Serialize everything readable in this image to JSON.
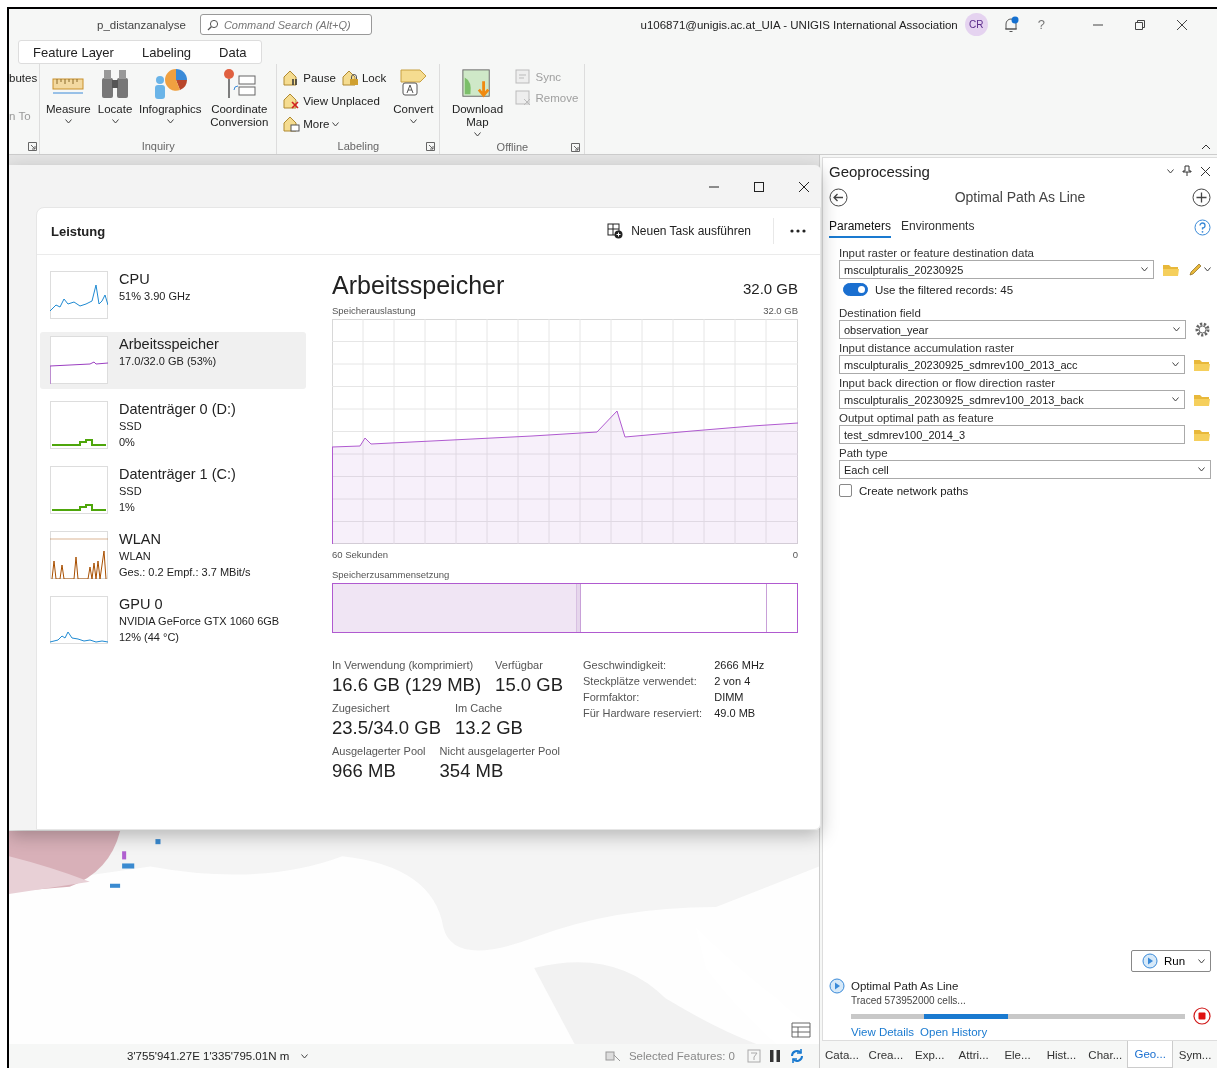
{
  "app": {
    "project": "p_distanzanalyse",
    "search_placeholder": "Command Search (Alt+Q)",
    "account": "u106871@unigis.ac.at_UIA - UNIGIS International Association",
    "avatar": "CR",
    "help": "?",
    "notification": true
  },
  "ribbon_tabs": [
    {
      "label": "Feature Layer"
    },
    {
      "label": "Labeling"
    },
    {
      "label": "Data"
    }
  ],
  "ribbon_cut_commands": [
    {
      "label": "butes",
      "disabled": false
    },
    {
      "label": "n To",
      "disabled": true
    }
  ],
  "ribbon_groups": [
    {
      "label": "Inquiry",
      "large": [
        {
          "kind": "measure",
          "label": "Measure",
          "dropdown": true
        },
        {
          "kind": "locate",
          "label": "Locate",
          "dropdown": true
        },
        {
          "kind": "infographics",
          "label": "Infographics",
          "dropdown": true
        },
        {
          "kind": "coordinate",
          "label": "Coordinate Conversion",
          "dropdown": false
        }
      ],
      "launcher": false
    },
    {
      "label": "Labeling",
      "small": [
        {
          "kind": "pause",
          "label": "Pause",
          "dropdown": false,
          "disabled": false
        },
        {
          "kind": "lock",
          "label": "Lock",
          "dropdown": false,
          "disabled": false
        },
        {
          "kind": "unplaced",
          "label": "View Unplaced",
          "dropdown": false,
          "disabled": false
        },
        {
          "kind": "more",
          "label": "More",
          "dropdown": true,
          "disabled": false
        }
      ],
      "large_after": [
        {
          "kind": "convert",
          "label": "Convert",
          "dropdown": true
        }
      ],
      "launcher": true
    },
    {
      "label": "Offline",
      "large": [
        {
          "kind": "download",
          "label": "Download Map",
          "dropdown": true
        }
      ],
      "small": [
        {
          "kind": "sync",
          "label": "Sync",
          "dropdown": false,
          "disabled": true
        },
        {
          "kind": "remove",
          "label": "Remove",
          "dropdown": false,
          "disabled": true
        }
      ],
      "launcher": true
    }
  ],
  "status_bar": {
    "coordinates": "3'755'941.27E 1'335'795.01N m",
    "selected_features": "Selected Features: 0"
  },
  "task_manager": {
    "section": "Leistung",
    "run_task": "Neuen Task ausführen",
    "resources": [
      {
        "kind": "cpu",
        "name": "CPU",
        "lines": [
          "51%  3.90 GHz"
        ],
        "color": "#1f8ad2",
        "selected": false
      },
      {
        "kind": "memory",
        "name": "Arbeitsspeicher",
        "lines": [
          "17.0/32.0 GB (53%)"
        ],
        "color": "#9b3fc1",
        "selected": true
      },
      {
        "kind": "disk",
        "name": "Datenträger 0 (D:)",
        "lines": [
          "SSD",
          "0%"
        ],
        "color": "#4ea60b",
        "selected": false
      },
      {
        "kind": "disk",
        "name": "Datenträger 1 (C:)",
        "lines": [
          "SSD",
          "1%"
        ],
        "color": "#4ea60b",
        "selected": false
      },
      {
        "kind": "network",
        "name": "WLAN",
        "lines": [
          "WLAN",
          "Ges.: 0.2 Empf.: 3.7 MBit/s"
        ],
        "color": "#a84f00",
        "selected": false
      },
      {
        "kind": "gpu",
        "name": "GPU 0",
        "lines": [
          "NVIDIA GeForce GTX 1060 6GB",
          "12%  (44 °C)"
        ],
        "color": "#1f8ad2",
        "selected": false
      }
    ],
    "detail": {
      "title": "Arbeitsspeicher",
      "total": "32.0 GB",
      "usage_label": "Speicherauslastung",
      "usage_max": "32.0 GB",
      "time_start": "60 Sekunden",
      "time_end": "0",
      "composition_label": "Speicherzusammensetzung",
      "stats": [
        [
          {
            "label": "In Verwendung (komprimiert)",
            "value": "16.6 GB (129 MB)"
          },
          {
            "label": "Verfügbar",
            "value": "15.0 GB"
          }
        ],
        [
          {
            "label": "Zugesichert",
            "value": "23.5/34.0 GB"
          },
          {
            "label": "Im Cache",
            "value": "13.2 GB"
          }
        ],
        [
          {
            "label": "Ausgelagerter Pool",
            "value": "966 MB"
          },
          {
            "label": "Nicht ausgelagerter Pool",
            "value": "354 MB"
          }
        ]
      ],
      "specs": [
        {
          "label": "Geschwindigkeit:",
          "value": "2666 MHz"
        },
        {
          "label": "Steckplätze verwendet:",
          "value": "2 von 4"
        },
        {
          "label": "Formfaktor:",
          "value": "DIMM"
        },
        {
          "label": "Für Hardware reserviert:",
          "value": "49.0 MB"
        }
      ]
    }
  },
  "geoprocessing": {
    "pane_title": "Geoprocessing",
    "tool_title": "Optimal Path As Line",
    "tabs": [
      {
        "label": "Parameters",
        "selected": true
      },
      {
        "label": "Environments",
        "selected": false
      }
    ],
    "parameters": [
      {
        "kind": "dropdown",
        "label": "Input raster or feature destination data",
        "value": "msculpturalis_20230925",
        "browse": true,
        "edit": true,
        "options": false
      },
      {
        "kind": "toggle",
        "label": "Use the filtered records: 45",
        "on": true
      },
      {
        "kind": "dropdown",
        "label": "Destination field",
        "value": "observation_year",
        "browse": false,
        "edit": false,
        "options": true
      },
      {
        "kind": "dropdown",
        "label": "Input distance accumulation raster",
        "value": "msculpturalis_20230925_sdmrev100_2013_acc",
        "browse": true,
        "edit": false,
        "options": false
      },
      {
        "kind": "dropdown",
        "label": "Input back direction or flow direction raster",
        "value": "msculpturalis_20230925_sdmrev100_2013_back",
        "browse": true,
        "edit": false,
        "options": false
      },
      {
        "kind": "text",
        "label": "Output optimal path as feature",
        "value": "test_sdmrev100_2014_3",
        "browse": true,
        "edit": false,
        "options": false
      },
      {
        "kind": "dropdown",
        "label": "Path type",
        "value": "Each cell",
        "browse": false,
        "edit": false,
        "options": false
      },
      {
        "kind": "checkbox",
        "label": "Create network paths",
        "checked": false
      }
    ],
    "run_button": "Run",
    "progress": {
      "tool": "Optimal Path As Line",
      "message": "Traced 573952000 cells...",
      "level": 0.25,
      "links": [
        "View Details",
        "Open History"
      ]
    },
    "dock_tabs": [
      {
        "label": "Cata...",
        "selected": false
      },
      {
        "label": "Crea...",
        "selected": false
      },
      {
        "label": "Exp...",
        "selected": false
      },
      {
        "label": "Attri...",
        "selected": false
      },
      {
        "label": "Ele...",
        "selected": false
      },
      {
        "label": "Hist...",
        "selected": false
      },
      {
        "label": "Char...",
        "selected": false
      },
      {
        "label": "Geo...",
        "selected": true
      },
      {
        "label": "Sym...",
        "selected": false
      }
    ]
  }
}
